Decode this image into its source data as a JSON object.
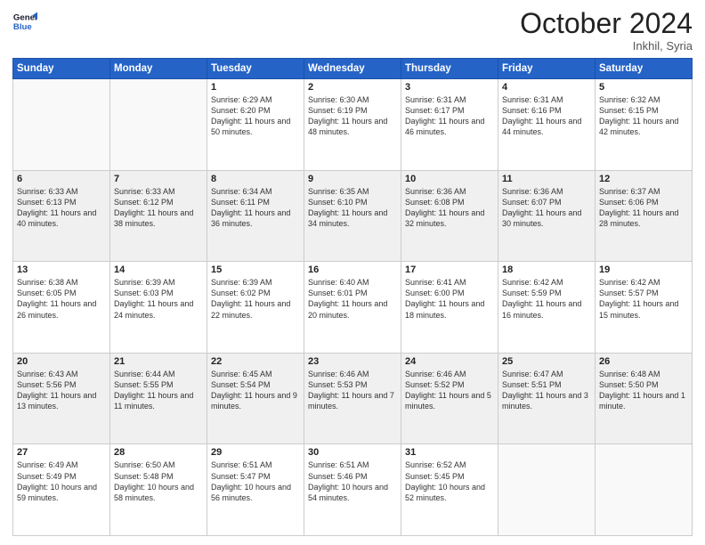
{
  "header": {
    "logo_line1": "General",
    "logo_line2": "Blue",
    "month": "October 2024",
    "location": "Inkhil, Syria"
  },
  "weekdays": [
    "Sunday",
    "Monday",
    "Tuesday",
    "Wednesday",
    "Thursday",
    "Friday",
    "Saturday"
  ],
  "weeks": [
    [
      {
        "day": "",
        "info": ""
      },
      {
        "day": "",
        "info": ""
      },
      {
        "day": "1",
        "info": "Sunrise: 6:29 AM\nSunset: 6:20 PM\nDaylight: 11 hours and 50 minutes."
      },
      {
        "day": "2",
        "info": "Sunrise: 6:30 AM\nSunset: 6:19 PM\nDaylight: 11 hours and 48 minutes."
      },
      {
        "day": "3",
        "info": "Sunrise: 6:31 AM\nSunset: 6:17 PM\nDaylight: 11 hours and 46 minutes."
      },
      {
        "day": "4",
        "info": "Sunrise: 6:31 AM\nSunset: 6:16 PM\nDaylight: 11 hours and 44 minutes."
      },
      {
        "day": "5",
        "info": "Sunrise: 6:32 AM\nSunset: 6:15 PM\nDaylight: 11 hours and 42 minutes."
      }
    ],
    [
      {
        "day": "6",
        "info": "Sunrise: 6:33 AM\nSunset: 6:13 PM\nDaylight: 11 hours and 40 minutes."
      },
      {
        "day": "7",
        "info": "Sunrise: 6:33 AM\nSunset: 6:12 PM\nDaylight: 11 hours and 38 minutes."
      },
      {
        "day": "8",
        "info": "Sunrise: 6:34 AM\nSunset: 6:11 PM\nDaylight: 11 hours and 36 minutes."
      },
      {
        "day": "9",
        "info": "Sunrise: 6:35 AM\nSunset: 6:10 PM\nDaylight: 11 hours and 34 minutes."
      },
      {
        "day": "10",
        "info": "Sunrise: 6:36 AM\nSunset: 6:08 PM\nDaylight: 11 hours and 32 minutes."
      },
      {
        "day": "11",
        "info": "Sunrise: 6:36 AM\nSunset: 6:07 PM\nDaylight: 11 hours and 30 minutes."
      },
      {
        "day": "12",
        "info": "Sunrise: 6:37 AM\nSunset: 6:06 PM\nDaylight: 11 hours and 28 minutes."
      }
    ],
    [
      {
        "day": "13",
        "info": "Sunrise: 6:38 AM\nSunset: 6:05 PM\nDaylight: 11 hours and 26 minutes."
      },
      {
        "day": "14",
        "info": "Sunrise: 6:39 AM\nSunset: 6:03 PM\nDaylight: 11 hours and 24 minutes."
      },
      {
        "day": "15",
        "info": "Sunrise: 6:39 AM\nSunset: 6:02 PM\nDaylight: 11 hours and 22 minutes."
      },
      {
        "day": "16",
        "info": "Sunrise: 6:40 AM\nSunset: 6:01 PM\nDaylight: 11 hours and 20 minutes."
      },
      {
        "day": "17",
        "info": "Sunrise: 6:41 AM\nSunset: 6:00 PM\nDaylight: 11 hours and 18 minutes."
      },
      {
        "day": "18",
        "info": "Sunrise: 6:42 AM\nSunset: 5:59 PM\nDaylight: 11 hours and 16 minutes."
      },
      {
        "day": "19",
        "info": "Sunrise: 6:42 AM\nSunset: 5:57 PM\nDaylight: 11 hours and 15 minutes."
      }
    ],
    [
      {
        "day": "20",
        "info": "Sunrise: 6:43 AM\nSunset: 5:56 PM\nDaylight: 11 hours and 13 minutes."
      },
      {
        "day": "21",
        "info": "Sunrise: 6:44 AM\nSunset: 5:55 PM\nDaylight: 11 hours and 11 minutes."
      },
      {
        "day": "22",
        "info": "Sunrise: 6:45 AM\nSunset: 5:54 PM\nDaylight: 11 hours and 9 minutes."
      },
      {
        "day": "23",
        "info": "Sunrise: 6:46 AM\nSunset: 5:53 PM\nDaylight: 11 hours and 7 minutes."
      },
      {
        "day": "24",
        "info": "Sunrise: 6:46 AM\nSunset: 5:52 PM\nDaylight: 11 hours and 5 minutes."
      },
      {
        "day": "25",
        "info": "Sunrise: 6:47 AM\nSunset: 5:51 PM\nDaylight: 11 hours and 3 minutes."
      },
      {
        "day": "26",
        "info": "Sunrise: 6:48 AM\nSunset: 5:50 PM\nDaylight: 11 hours and 1 minute."
      }
    ],
    [
      {
        "day": "27",
        "info": "Sunrise: 6:49 AM\nSunset: 5:49 PM\nDaylight: 10 hours and 59 minutes."
      },
      {
        "day": "28",
        "info": "Sunrise: 6:50 AM\nSunset: 5:48 PM\nDaylight: 10 hours and 58 minutes."
      },
      {
        "day": "29",
        "info": "Sunrise: 6:51 AM\nSunset: 5:47 PM\nDaylight: 10 hours and 56 minutes."
      },
      {
        "day": "30",
        "info": "Sunrise: 6:51 AM\nSunset: 5:46 PM\nDaylight: 10 hours and 54 minutes."
      },
      {
        "day": "31",
        "info": "Sunrise: 6:52 AM\nSunset: 5:45 PM\nDaylight: 10 hours and 52 minutes."
      },
      {
        "day": "",
        "info": ""
      },
      {
        "day": "",
        "info": ""
      }
    ]
  ]
}
